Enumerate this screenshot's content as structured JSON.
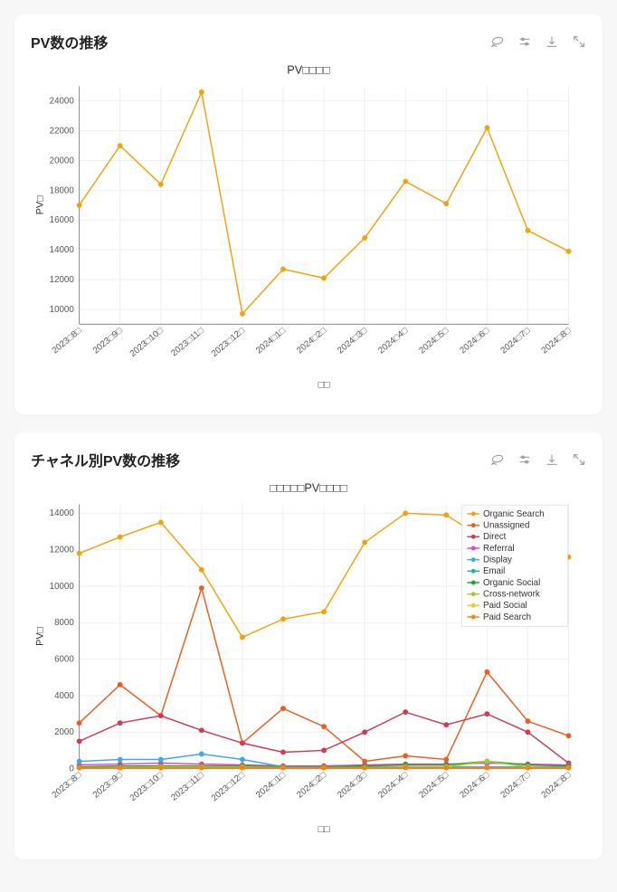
{
  "cards": [
    {
      "title": "PV数の推移"
    },
    {
      "title": "チャネル別PV数の推移"
    }
  ],
  "toolbar_icons": [
    "select-lasso",
    "settings-sliders",
    "download",
    "expand"
  ],
  "chart_data": [
    {
      "type": "line",
      "title": "PV□□□□",
      "xlabel": "□□",
      "ylabel": "PV□",
      "ylim": [
        9000,
        25000
      ],
      "ytick_step": 2000,
      "categories": [
        "2023□8□",
        "2023□9□",
        "2023□10□",
        "2023□11□",
        "2023□12□",
        "2024□1□",
        "2024□2□",
        "2024□3□",
        "2024□4□",
        "2024□5□",
        "2024□6□",
        "2024□7□",
        "2024□8□"
      ],
      "series": [
        {
          "name": "PV",
          "color": "#f0a30a",
          "values": [
            17000,
            21000,
            18400,
            24600,
            9700,
            12700,
            12100,
            14800,
            18600,
            17100,
            22200,
            15300,
            13900
          ]
        }
      ]
    },
    {
      "type": "line",
      "title": "□□□□□PV□□□□",
      "xlabel": "□□",
      "ylabel": "PV□",
      "ylim": [
        0,
        14500
      ],
      "ytick_step": 2000,
      "categories": [
        "2023□8□",
        "2023□9□",
        "2023□10□",
        "2023□11□",
        "2023□12□",
        "2024□1□",
        "2024□2□",
        "2024□3□",
        "2024□4□",
        "2024□5□",
        "2024□6□",
        "2024□7□",
        "2024□8□"
      ],
      "legend_position": "right-top",
      "series": [
        {
          "name": "Organic Search",
          "color": "#f0a30a",
          "values": [
            11800,
            12700,
            13500,
            10900,
            7200,
            8200,
            8600,
            12400,
            14000,
            13900,
            12500,
            11200,
            11600
          ]
        },
        {
          "name": "Unassigned",
          "color": "#eb5d1e",
          "values": [
            2500,
            4600,
            2900,
            9900,
            1400,
            3300,
            2300,
            400,
            700,
            500,
            5300,
            2600,
            1800
          ]
        },
        {
          "name": "Direct",
          "color": "#d23a52",
          "values": [
            1500,
            2500,
            2900,
            2100,
            1400,
            900,
            1000,
            2000,
            3100,
            2400,
            3000,
            2000,
            300
          ]
        },
        {
          "name": "Referral",
          "color": "#e83ec9",
          "values": [
            200,
            250,
            300,
            250,
            200,
            150,
            150,
            200,
            250,
            250,
            300,
            250,
            200
          ]
        },
        {
          "name": "Display",
          "color": "#3ea9e8",
          "values": [
            400,
            500,
            500,
            800,
            500,
            100,
            100,
            100,
            100,
            100,
            100,
            100,
            100
          ]
        },
        {
          "name": "Email",
          "color": "#1eb0a0",
          "values": [
            50,
            50,
            50,
            50,
            50,
            50,
            50,
            50,
            50,
            50,
            50,
            50,
            50
          ]
        },
        {
          "name": "Organic Social",
          "color": "#2ca02c",
          "values": [
            100,
            150,
            150,
            150,
            150,
            100,
            100,
            150,
            200,
            200,
            400,
            200,
            150
          ]
        },
        {
          "name": "Cross-network",
          "color": "#9acd32",
          "values": [
            50,
            50,
            100,
            100,
            100,
            50,
            50,
            50,
            100,
            100,
            400,
            100,
            50
          ]
        },
        {
          "name": "Paid Social",
          "color": "#f0c930",
          "values": [
            50,
            50,
            50,
            50,
            50,
            50,
            50,
            50,
            50,
            50,
            50,
            50,
            50
          ]
        },
        {
          "name": "Paid Search",
          "color": "#ff7f0e",
          "values": [
            50,
            50,
            50,
            50,
            50,
            50,
            50,
            50,
            50,
            50,
            50,
            50,
            50
          ]
        }
      ]
    }
  ]
}
